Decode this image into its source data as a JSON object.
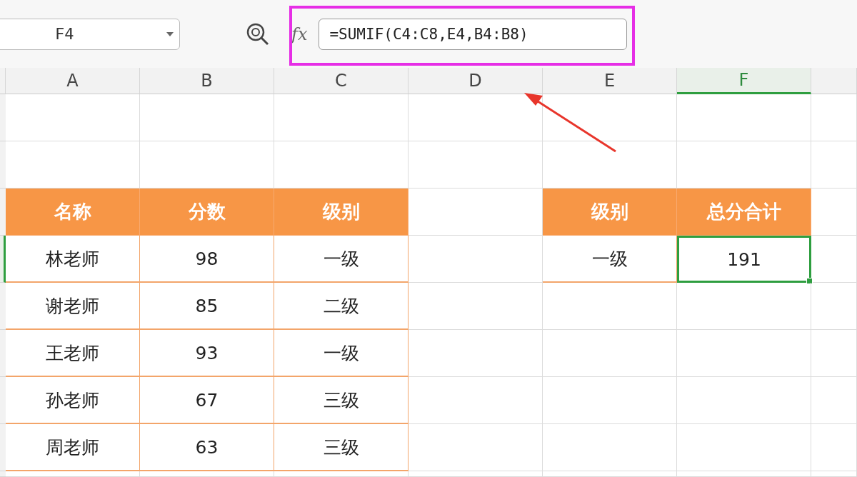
{
  "name_box": {
    "value": "F4"
  },
  "formula_bar": {
    "function_label": "fx",
    "value": "=SUMIF(C4:C8,E4,B4:B8)"
  },
  "annotations": {
    "highlight_box": true,
    "arrow": true
  },
  "columns": [
    {
      "label": "A",
      "selected": false
    },
    {
      "label": "B",
      "selected": false
    },
    {
      "label": "C",
      "selected": false
    },
    {
      "label": "D",
      "selected": false
    },
    {
      "label": "E",
      "selected": false
    },
    {
      "label": "F",
      "selected": true
    }
  ],
  "rows": [
    {
      "selected": false,
      "cells": [
        {
          "kind": "blank",
          "selected": false
        },
        {
          "kind": "blank",
          "selected": false
        },
        {
          "kind": "blank",
          "selected": false
        },
        {
          "kind": "blank",
          "selected": false
        },
        {
          "kind": "blank",
          "selected": false
        },
        {
          "kind": "blank",
          "selected": false
        }
      ]
    },
    {
      "selected": false,
      "cells": [
        {
          "kind": "blank",
          "selected": false
        },
        {
          "kind": "blank",
          "selected": false
        },
        {
          "kind": "blank",
          "selected": false
        },
        {
          "kind": "blank",
          "selected": false
        },
        {
          "kind": "blank",
          "selected": false
        },
        {
          "kind": "blank",
          "selected": false
        }
      ]
    },
    {
      "selected": false,
      "cells": [
        {
          "kind": "header",
          "text": "名称",
          "selected": false
        },
        {
          "kind": "header",
          "text": "分数",
          "selected": false
        },
        {
          "kind": "header",
          "text": "级别",
          "selected": false
        },
        {
          "kind": "blank",
          "selected": false
        },
        {
          "kind": "header",
          "text": "级别",
          "selected": false
        },
        {
          "kind": "header",
          "text": "总分合计",
          "selected": false
        }
      ]
    },
    {
      "selected": true,
      "cells": [
        {
          "kind": "data",
          "text": "林老师",
          "selected": false
        },
        {
          "kind": "data",
          "text": "98",
          "selected": false
        },
        {
          "kind": "data",
          "text": "一级",
          "selected": false
        },
        {
          "kind": "blank",
          "selected": false
        },
        {
          "kind": "data",
          "text": "一级",
          "selected": false
        },
        {
          "kind": "data",
          "text": "191",
          "selected": true
        }
      ]
    },
    {
      "selected": false,
      "cells": [
        {
          "kind": "data",
          "text": "谢老师",
          "selected": false
        },
        {
          "kind": "data",
          "text": "85",
          "selected": false
        },
        {
          "kind": "data",
          "text": "二级",
          "selected": false
        },
        {
          "kind": "blank",
          "selected": false
        },
        {
          "kind": "blank",
          "selected": false
        },
        {
          "kind": "blank",
          "selected": false
        }
      ]
    },
    {
      "selected": false,
      "cells": [
        {
          "kind": "data",
          "text": "王老师",
          "selected": false
        },
        {
          "kind": "data",
          "text": "93",
          "selected": false
        },
        {
          "kind": "data",
          "text": "一级",
          "selected": false
        },
        {
          "kind": "blank",
          "selected": false
        },
        {
          "kind": "blank",
          "selected": false
        },
        {
          "kind": "blank",
          "selected": false
        }
      ]
    },
    {
      "selected": false,
      "cells": [
        {
          "kind": "data",
          "text": "孙老师",
          "selected": false
        },
        {
          "kind": "data",
          "text": "67",
          "selected": false
        },
        {
          "kind": "data",
          "text": "三级",
          "selected": false
        },
        {
          "kind": "blank",
          "selected": false
        },
        {
          "kind": "blank",
          "selected": false
        },
        {
          "kind": "blank",
          "selected": false
        }
      ]
    },
    {
      "selected": false,
      "cells": [
        {
          "kind": "data",
          "text": "周老师",
          "selected": false
        },
        {
          "kind": "data",
          "text": "63",
          "selected": false
        },
        {
          "kind": "data",
          "text": "三级",
          "selected": false
        },
        {
          "kind": "blank",
          "selected": false
        },
        {
          "kind": "blank",
          "selected": false
        },
        {
          "kind": "blank",
          "selected": false
        }
      ]
    }
  ]
}
